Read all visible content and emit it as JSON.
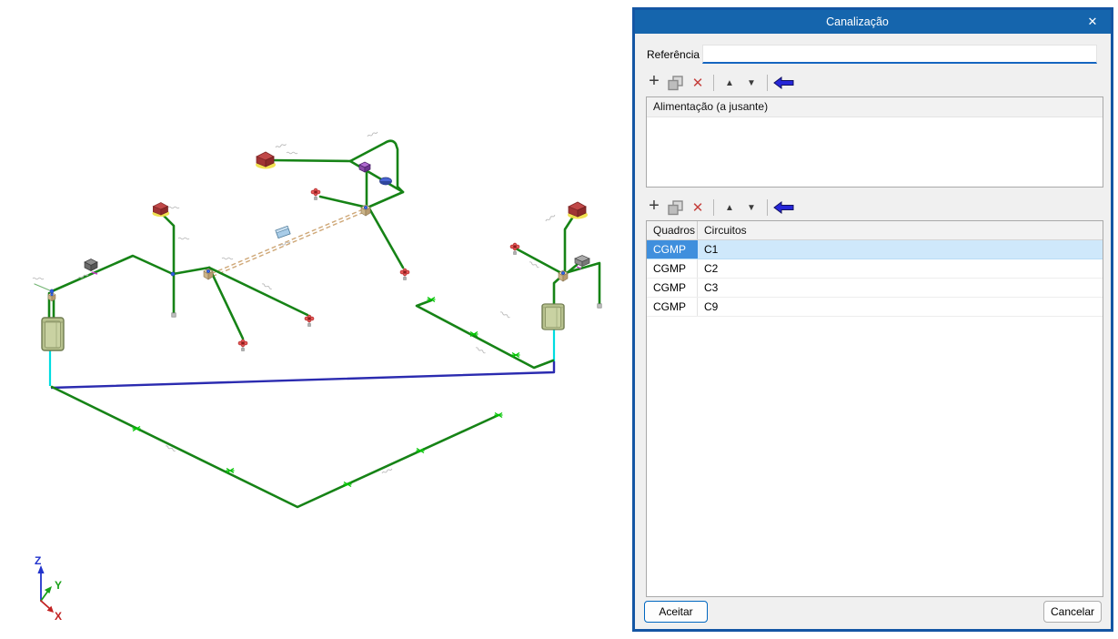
{
  "window": {
    "title": "Canalização",
    "close_glyph": "✕"
  },
  "form": {
    "reference_label": "Referência",
    "reference_value": ""
  },
  "icons": {
    "glyphs": {
      "add": "+",
      "delete": "✕",
      "move_up": "▲",
      "move_down": "▼"
    },
    "toolbar_names": [
      "add-icon",
      "copy-icon",
      "delete-icon",
      "move-up-icon",
      "move-down-icon",
      "back-arrow-icon"
    ]
  },
  "feed_list": {
    "items": [
      "Alimentação (a jusante)"
    ]
  },
  "table": {
    "headers": [
      "Quadros",
      "Circuitos"
    ],
    "rows": [
      {
        "quadro": "CGMP",
        "circuito": "C1"
      },
      {
        "quadro": "CGMP",
        "circuito": "C2"
      },
      {
        "quadro": "CGMP",
        "circuito": "C3"
      },
      {
        "quadro": "CGMP",
        "circuito": "C9"
      }
    ],
    "selected_index": 0
  },
  "buttons": {
    "accept": "Aceitar",
    "cancel": "Cancelar"
  },
  "axes": {
    "x": "X",
    "y": "Y",
    "z": "Z"
  },
  "colors": {
    "titlebar": "#1565ad",
    "selection": "#3f8fdd",
    "selection_light": "#cfe8fb",
    "pipe_green": "#168316",
    "marker_green": "#00c400",
    "navy_feeder": "#2b2bb0",
    "cyan_riser": "#00dce0",
    "conduit_dashed_tan": "#cfa878"
  }
}
